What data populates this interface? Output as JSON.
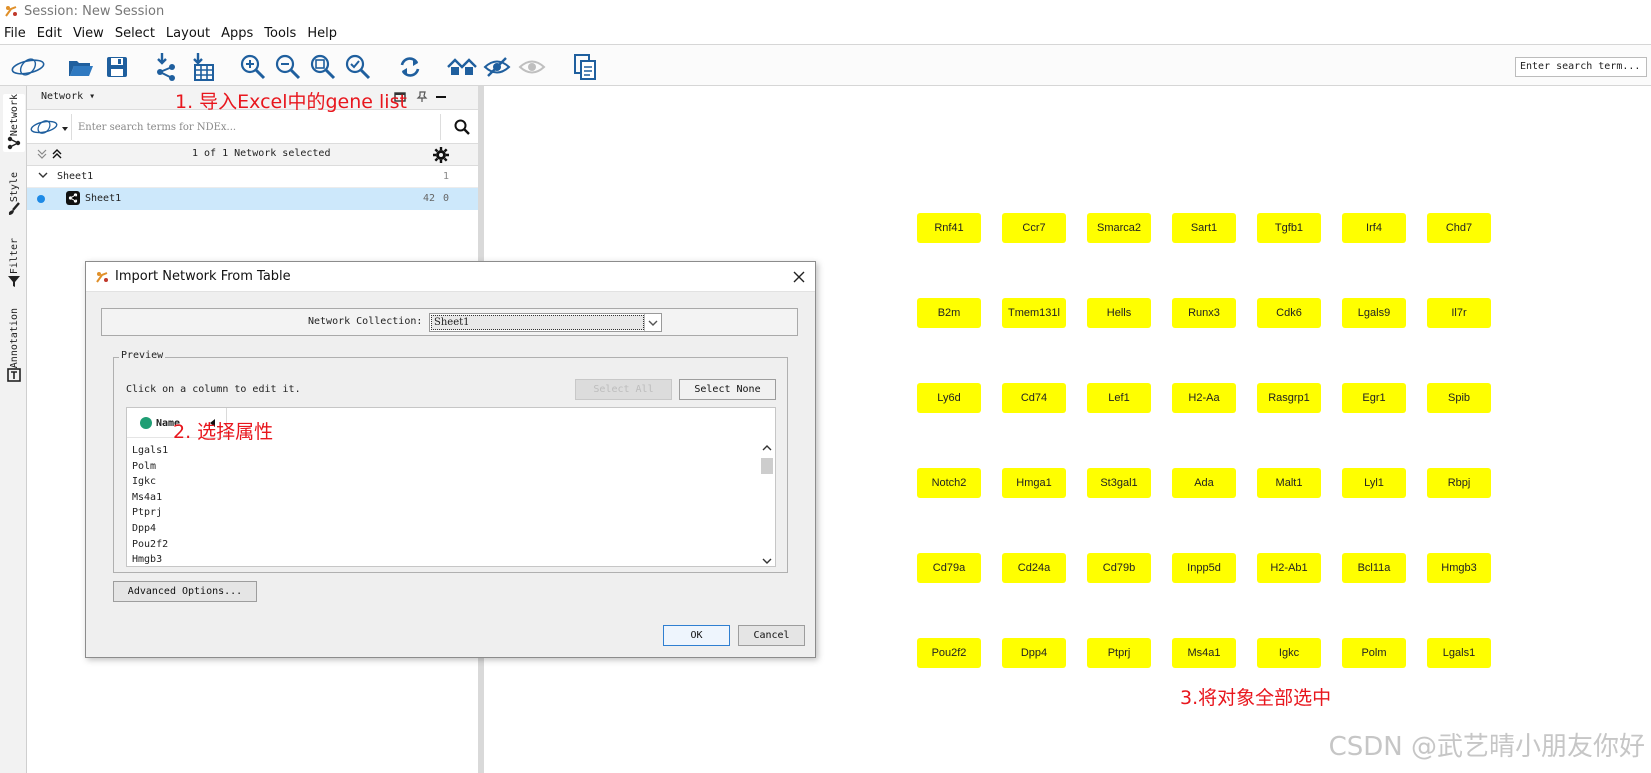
{
  "window": {
    "title": "Session: New Session"
  },
  "menu": [
    "File",
    "Edit",
    "View",
    "Select",
    "Layout",
    "Apps",
    "Tools",
    "Help"
  ],
  "toolbar": {
    "search_placeholder": "Enter search term..."
  },
  "side_tabs": [
    "Network",
    "Style",
    "Filter",
    "Annotation"
  ],
  "panel": {
    "header_label": "Network ▾",
    "ndex_placeholder": "Enter search terms for NDEx...",
    "selected_text": "1 of 1 Network selected",
    "collection": {
      "name": "Sheet1",
      "count": "1"
    },
    "network": {
      "name": "Sheet1",
      "nodes": "42",
      "edges": "0"
    }
  },
  "dialog": {
    "title": "Import Network From Table",
    "collection_label": "Network Collection:",
    "collection_value": "Sheet1",
    "preview_legend": "Preview",
    "hint": "Click on a column to edit it.",
    "select_all": "Select All",
    "select_none": "Select None",
    "column_header": "Name",
    "rows": [
      "Lgals1",
      "Polm",
      "Igkc",
      "Ms4a1",
      "Ptprj",
      "Dpp4",
      "Pou2f2",
      "Hmgb3"
    ],
    "advanced": "Advanced Options...",
    "ok": "OK",
    "cancel": "Cancel"
  },
  "nodes": [
    [
      "Rnf41",
      "Ccr7",
      "Smarca2",
      "Sart1",
      "Tgfb1",
      "Irf4",
      "Chd7"
    ],
    [
      "B2m",
      "Tmem131l",
      "Hells",
      "Runx3",
      "Cdk6",
      "Lgals9",
      "Il7r"
    ],
    [
      "Ly6d",
      "Cd74",
      "Lef1",
      "H2-Aa",
      "Rasgrp1",
      "Egr1",
      "Spib"
    ],
    [
      "Notch2",
      "Hmga1",
      "St3gal1",
      "Ada",
      "Malt1",
      "Lyl1",
      "Rbpj"
    ],
    [
      "Cd79a",
      "Cd24a",
      "Cd79b",
      "Inpp5d",
      "H2-Ab1",
      "Bcl11a",
      "Hmgb3"
    ],
    [
      "Pou2f2",
      "Dpp4",
      "Ptprj",
      "Ms4a1",
      "Igkc",
      "Polm",
      "Lgals1"
    ]
  ],
  "annotations": {
    "step1": "1. 导入Excel中的gene list",
    "step2": "2. 选择属性",
    "step3": "3.将对象全部选中"
  },
  "watermark": "CSDN @武艺晴小朋友你好",
  "colors": {
    "node_fill": "#ffff00",
    "annotation": "#e8161d",
    "selection": "#cde8fb",
    "brand_blue": "#1f5f9e"
  }
}
